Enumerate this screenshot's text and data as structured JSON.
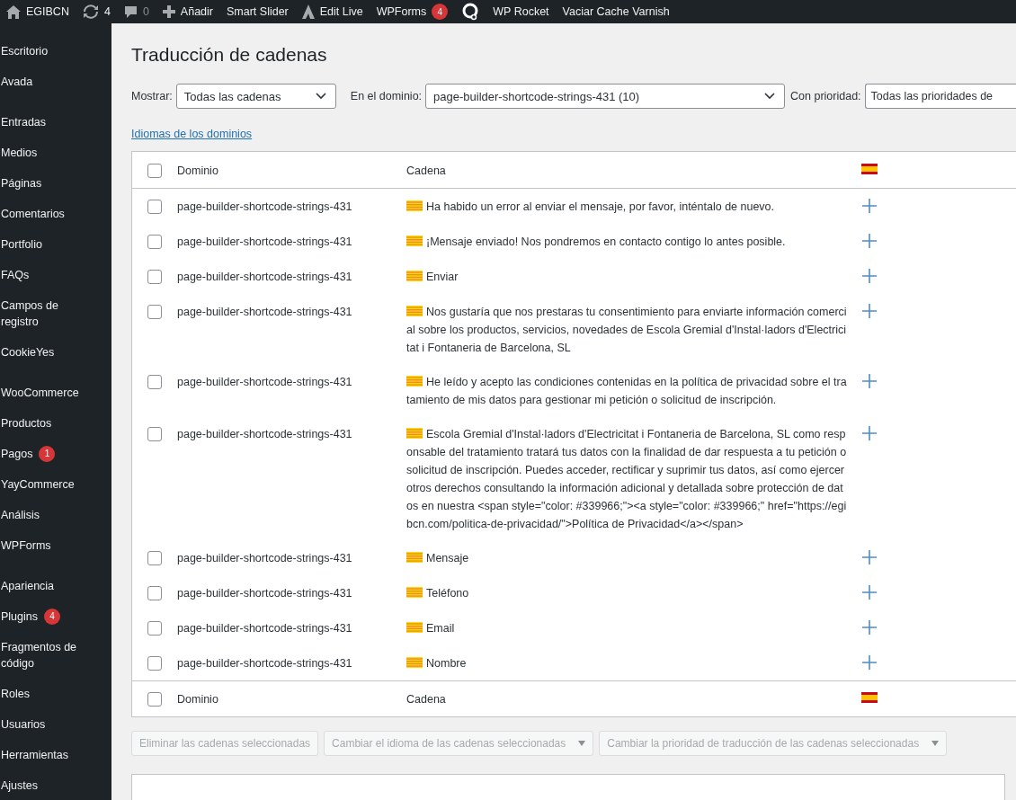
{
  "admin_bar": [
    {
      "kind": "home",
      "label": "EGIBCN"
    },
    {
      "kind": "updates",
      "label": "4"
    },
    {
      "kind": "comments",
      "label": "0"
    },
    {
      "kind": "new",
      "label": "Añadir"
    },
    {
      "kind": "text",
      "label": "Smart Slider"
    },
    {
      "kind": "live",
      "label": "Edit Live"
    },
    {
      "kind": "text",
      "label": "WPForms",
      "badge": "4"
    },
    {
      "kind": "logo"
    },
    {
      "kind": "text",
      "label": "WP Rocket"
    },
    {
      "kind": "text",
      "label": "Vaciar Cache Varnish"
    }
  ],
  "sidebar": {
    "groups": [
      [
        {
          "label": "Escritorio"
        },
        {
          "label": "Avada"
        }
      ],
      [
        {
          "label": "Entradas"
        },
        {
          "label": "Medios"
        },
        {
          "label": "Páginas"
        },
        {
          "label": "Comentarios"
        },
        {
          "label": "Portfolio"
        },
        {
          "label": "FAQs"
        },
        {
          "label": "Campos de registro"
        },
        {
          "label": "CookieYes"
        }
      ],
      [
        {
          "label": "WooCommerce"
        },
        {
          "label": "Productos"
        },
        {
          "label": "Pagos",
          "badge": "1"
        },
        {
          "label": "YayCommerce"
        },
        {
          "label": "Análisis"
        },
        {
          "label": "WPForms"
        }
      ],
      [
        {
          "label": "Apariencia"
        },
        {
          "label": "Plugins",
          "badge": "4"
        },
        {
          "label": "Fragmentos de código"
        },
        {
          "label": "Roles"
        },
        {
          "label": "Usuarios"
        },
        {
          "label": "Herramientas"
        },
        {
          "label": "Ajustes"
        }
      ]
    ]
  },
  "title": "Traducción de cadenas",
  "filters": [
    {
      "label": "Mostrar:",
      "value": "Todas las cadenas",
      "kind": "select"
    },
    {
      "label": "En el dominio:",
      "value": "page-builder-shortcode-strings-431 (10)",
      "kind": "select"
    },
    {
      "label": "Con prioridad:",
      "value": "Todas las prioridades de",
      "kind": "cut"
    }
  ],
  "domains_link": "Idiomas de los dominios",
  "table": {
    "header": {
      "checked": false,
      "columns": [
        "Dominio",
        "Cadena"
      ]
    },
    "footer": {
      "checked": false,
      "columns": [
        "Dominio",
        "Cadena"
      ]
    },
    "rows": [
      {
        "checked": false,
        "domain": "page-builder-shortcode-strings-431",
        "string": "Ha habido un error al enviar el mensaje, por favor, inténtalo de nuevo."
      },
      {
        "checked": false,
        "domain": "page-builder-shortcode-strings-431",
        "string": "¡Mensaje enviado! Nos pondremos en contacto contigo lo antes posible."
      },
      {
        "checked": false,
        "domain": "page-builder-shortcode-strings-431",
        "string": "Enviar"
      },
      {
        "checked": false,
        "domain": "page-builder-shortcode-strings-431",
        "string": "Nos gustaría que nos prestaras tu consentimiento para enviarte información comercial sobre los productos, servicios, novedades de Escola Gremial d'Instal·ladors d'Electricitat i Fontaneria de Barcelona, SL"
      },
      {
        "checked": false,
        "domain": "page-builder-shortcode-strings-431",
        "string": "He leído y acepto las condiciones contenidas en la política de privacidad sobre el tratamiento de mis datos para gestionar mi petición o solicitud de inscripción."
      },
      {
        "checked": false,
        "domain": "page-builder-shortcode-strings-431",
        "string": "Escola Gremial d'Instal·ladors d'Electricitat i Fontaneria de Barcelona, SL como responsable del tratamiento tratará tus datos con la finalidad de dar respuesta a tu petición o solicitud de inscripción. Puedes acceder, rectificar y suprimir tus datos, así como ejercer otros derechos consultando la información adicional y detallada sobre protección de datos en nuestra <span style=\"color: #339966;\"><a style=\"color: #339966;\" href=\"https://egibcn.com/politica-de-privacidad/\">Política de Privacidad</a></span>"
      },
      {
        "checked": false,
        "domain": "page-builder-shortcode-strings-431",
        "string": "Mensaje"
      },
      {
        "checked": false,
        "domain": "page-builder-shortcode-strings-431",
        "string": "Teléfono"
      },
      {
        "checked": false,
        "domain": "page-builder-shortcode-strings-431",
        "string": "Email"
      },
      {
        "checked": false,
        "domain": "page-builder-shortcode-strings-431",
        "string": "Nombre"
      }
    ]
  },
  "bulk_actions": [
    {
      "label": "Eliminar las cadenas seleccionadas",
      "kind": "button"
    },
    {
      "label": "Cambiar el idioma de las cadenas seleccionadas",
      "kind": "select"
    },
    {
      "label": "Cambiar la prioridad de traducción de las cadenas seleccionadas",
      "kind": "select"
    }
  ]
}
